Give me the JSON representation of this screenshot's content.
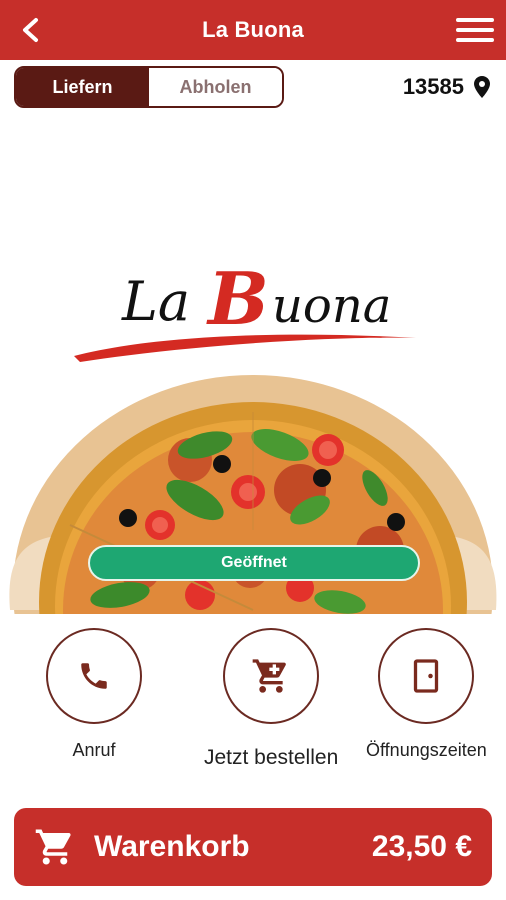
{
  "header": {
    "title": "La Buona",
    "back_icon": "chevron-left-icon",
    "menu_icon": "hamburger-menu-icon"
  },
  "order_mode": {
    "options": [
      "Liefern",
      "Abholen"
    ],
    "selected": "Liefern"
  },
  "location": {
    "zip": "13585",
    "icon": "location-pin-icon"
  },
  "logo": {
    "text_part1": "La",
    "text_part2": "B",
    "text_part3": "uona"
  },
  "status": {
    "label": "Geöffnet",
    "color": "#1ea772"
  },
  "actions": [
    {
      "label": "Anruf",
      "icon": "phone-icon"
    },
    {
      "label": "Jetzt bestellen",
      "icon": "cart-icon"
    },
    {
      "label": "Öffnungszeiten",
      "icon": "door-icon"
    }
  ],
  "cart": {
    "label": "Warenkorb",
    "total": "23,50 €",
    "icon": "cart-icon"
  },
  "colors": {
    "brand": "#c62f2a",
    "dark": "#5a1a14",
    "status": "#1ea772"
  }
}
